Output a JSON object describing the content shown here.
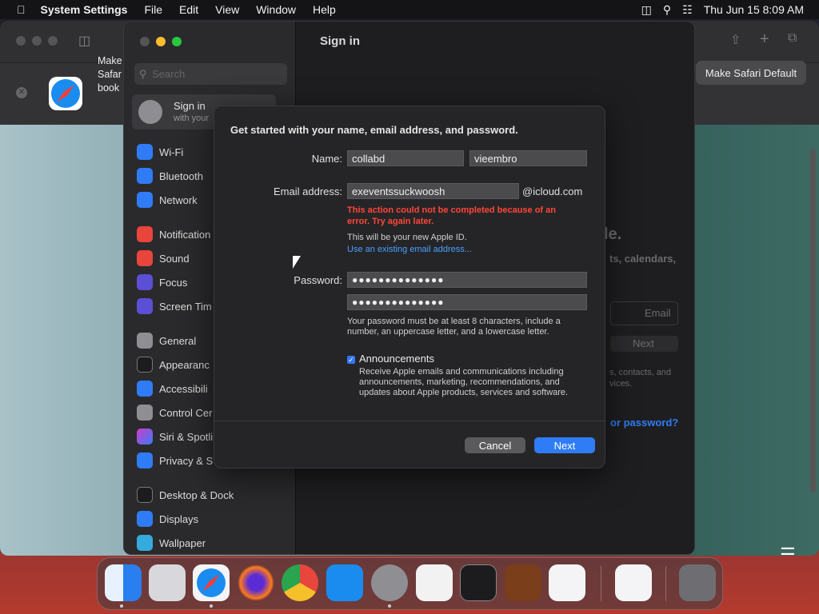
{
  "menubar": {
    "app": "System Settings",
    "items": [
      "File",
      "Edit",
      "View",
      "Window",
      "Help"
    ],
    "datetime": "Thu Jun 15  8:09 AM"
  },
  "safari": {
    "banner_text": "Make\nSafar\nbook",
    "make_default": "Make Safari Default"
  },
  "settings": {
    "search_placeholder": "Search",
    "signin_title": "Sign in",
    "signin_sub": "with your",
    "page_title": "Sign in",
    "sidebar": [
      "Wi-Fi",
      "Bluetooth",
      "Network",
      "Notification",
      "Sound",
      "Focus",
      "Screen Tim",
      "General",
      "Appearanc",
      "Accessibili",
      "Control Cer",
      "Siri & Spotli",
      "Privacy & S",
      "Desktop & Dock",
      "Displays",
      "Wallpaper"
    ],
    "ghost": {
      "a": "le.",
      "b": "ts, calendars,",
      "email": "Email",
      "next": "Next",
      "c": "s, contacts, and",
      "d": "vices.",
      "e": "or password?"
    }
  },
  "dialog": {
    "title": "Get started with your name, email address, and password.",
    "name_label": "Name:",
    "first_name": "collabd",
    "last_name": "vieembro",
    "email_label": "Email address:",
    "email_value": "exeventssuckwoosh",
    "email_suffix": "@icloud.com",
    "error": "This action could not be completed because of an error. Try again later.",
    "hint": "This will be your new Apple ID.",
    "link": "Use an existing email address...",
    "password_label": "Password:",
    "password_mask": "●●●●●●●●●●●●●●",
    "verify_mask": "●●●●●●●●●●●●●●",
    "password_hint": "Your password must be at least 8 characters, include a number, an uppercase letter, and a lowercase letter.",
    "announcements_label": "Announcements",
    "announcements_checked": true,
    "announcements_desc": "Receive Apple emails and communications including announcements, marketing, recommendations, and updates about Apple products, services and software.",
    "cancel": "Cancel",
    "next": "Next"
  },
  "colors": {
    "accent": "#2f7cf6",
    "error": "#ff453a",
    "link": "#4aa0ff"
  }
}
